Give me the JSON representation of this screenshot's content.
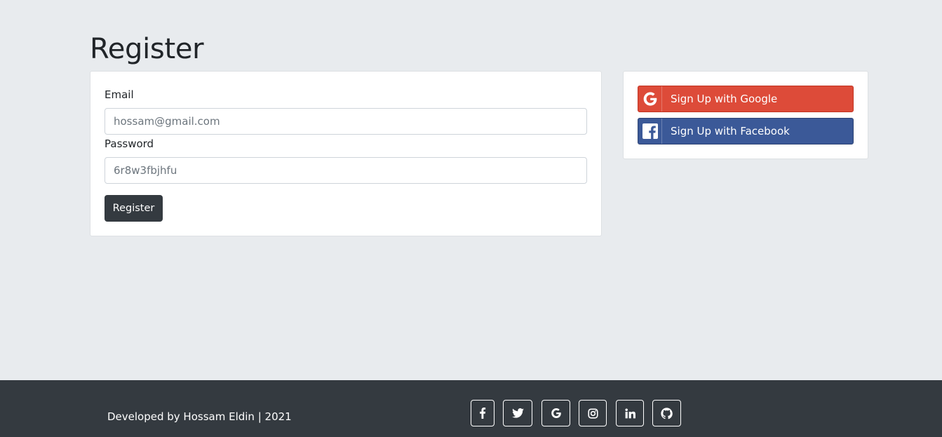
{
  "page": {
    "title": "Register"
  },
  "form": {
    "email_label": "Email",
    "email_placeholder": "hossam@gmail.com",
    "password_label": "Password",
    "password_placeholder": "6r8w3fbjhfu",
    "submit_label": "Register"
  },
  "social": {
    "google_label": "Sign Up with Google",
    "facebook_label": "Sign Up with Facebook",
    "google_color": "#dd4b39",
    "facebook_color": "#3b5998"
  },
  "footer": {
    "text": "Developed by Hossam Eldin | 2021",
    "icons": [
      "facebook-icon",
      "twitter-icon",
      "google-icon",
      "instagram-icon",
      "linkedin-icon",
      "github-icon"
    ]
  },
  "colors": {
    "background": "#e8ebee",
    "dark": "#343a40"
  }
}
